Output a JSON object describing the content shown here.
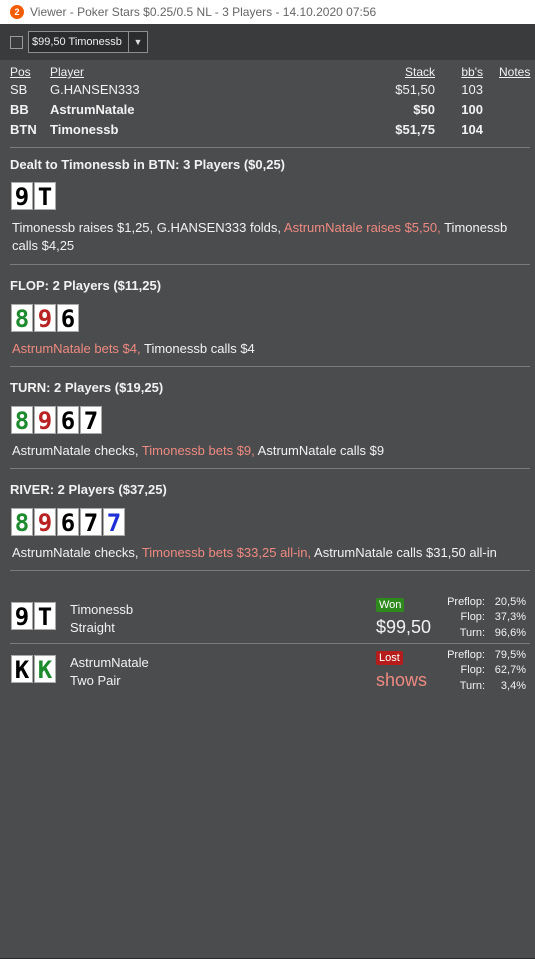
{
  "window": {
    "icon_glyph": "2",
    "title": "Viewer - Poker Stars $0.25/0.5 NL - 3 Players - 14.10.2020 07:56"
  },
  "toolbar": {
    "player_select": "$99,50 Timonessb"
  },
  "table": {
    "headers": {
      "pos": "Pos",
      "player": "Player",
      "stack": "Stack",
      "bbs": "bb's",
      "notes": "Notes"
    },
    "rows": [
      {
        "pos": "SB",
        "player": "G.HANSEN333",
        "stack": "$51,50",
        "bbs": "103",
        "bold": false
      },
      {
        "pos": "BB",
        "player": "AstrumNatale",
        "stack": "$50",
        "bbs": "100",
        "bold": true
      },
      {
        "pos": "BTN",
        "player": "Timonessb",
        "stack": "$51,75",
        "bbs": "104",
        "bold": true
      }
    ]
  },
  "streets": {
    "preflop": {
      "title": "Dealt to Timonessb in BTN: 3 Players ($0,25)",
      "cards": [
        {
          "rank": "9",
          "suit": "spade"
        },
        {
          "rank": "T",
          "suit": "spade"
        }
      ],
      "action_1": "Timonessb raises $1,25, G.HANSEN333 folds, ",
      "action_2": "AstrumNatale raises $5,50,",
      "action_3": " Timonessb",
      "action_4": "calls $4,25"
    },
    "flop": {
      "title": "FLOP: 2 Players ($11,25)",
      "cards": [
        {
          "rank": "8",
          "suit": "club"
        },
        {
          "rank": "9",
          "suit": "heart"
        },
        {
          "rank": "6",
          "suit": "spade"
        }
      ],
      "action_1": "AstrumNatale bets $4,",
      "action_2": " Timonessb calls $4"
    },
    "turn": {
      "title": "TURN: 2 Players ($19,25)",
      "cards": [
        {
          "rank": "8",
          "suit": "club"
        },
        {
          "rank": "9",
          "suit": "heart"
        },
        {
          "rank": "6",
          "suit": "spade"
        },
        {
          "rank": "7",
          "suit": "spade"
        }
      ],
      "action_1": "AstrumNatale checks, ",
      "action_2": "Timonessb bets $9,",
      "action_3": " AstrumNatale calls $9"
    },
    "river": {
      "title": "RIVER: 2 Players ($37,25)",
      "cards": [
        {
          "rank": "8",
          "suit": "club"
        },
        {
          "rank": "9",
          "suit": "heart"
        },
        {
          "rank": "6",
          "suit": "spade"
        },
        {
          "rank": "7",
          "suit": "spade"
        },
        {
          "rank": "7",
          "suit": "diamond"
        }
      ],
      "action_1": "AstrumNatale checks, ",
      "action_2": "Timonessb bets $33,25 all-in,",
      "action_3": " AstrumNatale calls $31,50 all-in"
    }
  },
  "results": [
    {
      "cards": [
        {
          "rank": "9",
          "suit": "spade"
        },
        {
          "rank": "T",
          "suit": "spade"
        }
      ],
      "player": "Timonessb",
      "hand": "Straight",
      "badge": "Won",
      "amount": "$99,50",
      "equity": {
        "preflop_label": "Preflop:",
        "preflop": "20,5%",
        "flop_label": "Flop:",
        "flop": "37,3%",
        "turn_label": "Turn:",
        "turn": "96,6%"
      }
    },
    {
      "cards": [
        {
          "rank": "K",
          "suit": "spade"
        },
        {
          "rank": "K",
          "suit": "club"
        }
      ],
      "player": "AstrumNatale",
      "hand": "Two Pair",
      "badge": "Lost",
      "amount": "shows",
      "equity": {
        "preflop_label": "Preflop:",
        "preflop": "79,5%",
        "flop_label": "Flop:",
        "flop": "62,7%",
        "turn_label": "Turn:",
        "turn": "3,4%"
      }
    }
  ],
  "colors": {
    "background": "#4b4c4e",
    "highlight": "#ef8a80",
    "won": "#2f8a1e",
    "lost": "#b51d1d",
    "club": "#1d8a2e",
    "heart": "#b82222",
    "diamond": "#1f2fd8"
  }
}
